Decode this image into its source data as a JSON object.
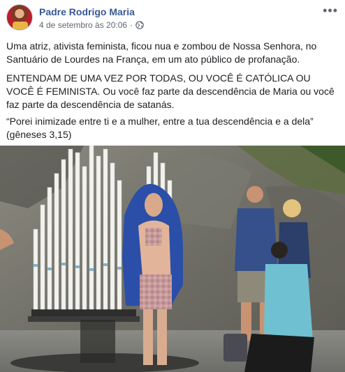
{
  "post": {
    "author": "Padre Rodrigo Maria",
    "date": "4 de setembro às 20:06",
    "privacy_icon": "globe-icon",
    "more_icon": "more-options-icon",
    "paragraphs": [
      "Uma atriz, ativista feminista, ficou nua e zombou de Nossa Senhora, no Santuário de Lourdes na França, em um ato público de profanação.",
      "ENTENDAM DE UMA VEZ POR TODAS, OU VOCÊ É CATÓLICA OU VOCÊ É FEMINISTA. Ou você faz parte da descendência de Maria ou você faz parte da descendência de satanás.",
      "“Porei inimizade entre ti e a mulher, entre a tua descendência e a dela” (gêneses 3,15)"
    ]
  },
  "colors": {
    "author_link": "#385898",
    "meta_text": "#606770",
    "body_text": "#1c1e21"
  }
}
